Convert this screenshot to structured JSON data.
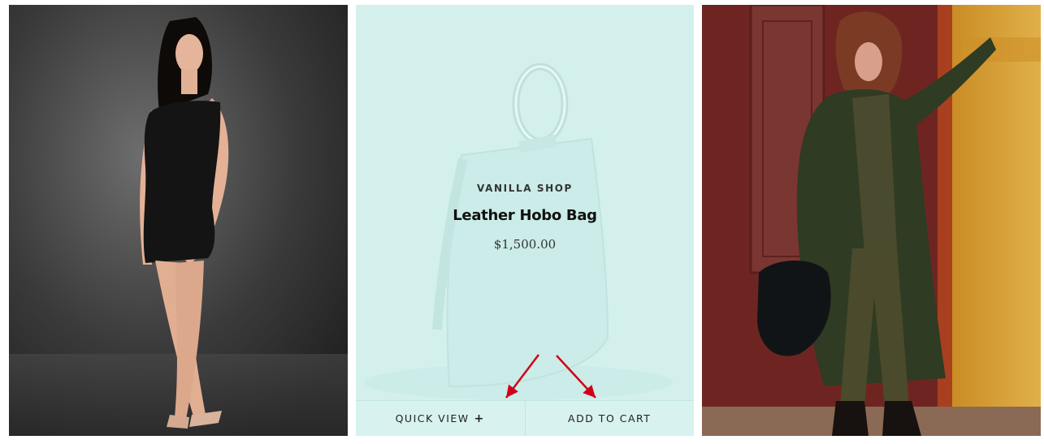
{
  "products": [
    {
      "image_alt": "Model in black sequin mini dress",
      "image_icon": "photo-black-dress",
      "colors": {
        "bg_top": "#2a2a2a",
        "bg_mid": "#5a5a5a",
        "dress": "#151515",
        "skin": "#e8b59a"
      }
    },
    {
      "vendor": "VANILLA SHOP",
      "title": "Leather Hobo Bag",
      "price": "$1,500.00",
      "quick_view_label": "QUICK VIEW",
      "quick_view_icon": "+",
      "add_to_cart_label": "ADD TO CART",
      "colors": {
        "overlay": "#d3f0ed",
        "bag": "#e6f5f3",
        "annotation_arrow": "#d0021b"
      }
    },
    {
      "image_alt": "Model in long green coat with black bag",
      "image_icon": "photo-green-coat",
      "colors": {
        "wall_left": "#7a2a26",
        "wall_right": "#d49a2a",
        "coat": "#2f3b22"
      }
    }
  ]
}
